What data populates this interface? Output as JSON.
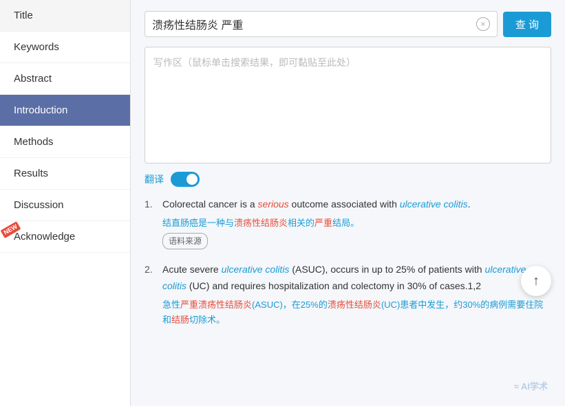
{
  "sidebar": {
    "items": [
      {
        "id": "title",
        "label": "Title",
        "active": false,
        "new": false
      },
      {
        "id": "keywords",
        "label": "Keywords",
        "active": false,
        "new": false
      },
      {
        "id": "abstract",
        "label": "Abstract",
        "active": false,
        "new": false
      },
      {
        "id": "introduction",
        "label": "Introduction",
        "active": true,
        "new": false
      },
      {
        "id": "methods",
        "label": "Methods",
        "active": false,
        "new": false
      },
      {
        "id": "results",
        "label": "Results",
        "active": false,
        "new": false
      },
      {
        "id": "discussion",
        "label": "Discussion",
        "active": false,
        "new": false
      },
      {
        "id": "acknowledge",
        "label": "Acknowledge",
        "active": false,
        "new": true
      }
    ]
  },
  "search": {
    "query": "溃疡性结肠炎 严重",
    "button_label": "查 询",
    "clear_icon": "×"
  },
  "writing_area": {
    "placeholder": "写作区（鼠标单击搜索结果，即可黏贴至此处）"
  },
  "translate": {
    "label": "翻译",
    "enabled": true
  },
  "results": [
    {
      "number": "1.",
      "en_parts": [
        {
          "text": "Colorectal cancer is a ",
          "type": "normal"
        },
        {
          "text": "serious",
          "type": "italic-red"
        },
        {
          "text": " outcome associated with ",
          "type": "normal"
        },
        {
          "text": "ulcerative colitis",
          "type": "italic-blue"
        },
        {
          "text": ".",
          "type": "normal"
        }
      ],
      "cn_parts": [
        {
          "text": "结直肠癌是一种与",
          "type": "normal"
        },
        {
          "text": "溃疡性结肠炎",
          "type": "cn-red"
        },
        {
          "text": "相关的",
          "type": "normal"
        },
        {
          "text": "严重",
          "type": "cn-red"
        },
        {
          "text": "结局。",
          "type": "normal"
        }
      ],
      "source": "语料来源"
    },
    {
      "number": "2.",
      "en_parts": [
        {
          "text": "Acute severe ",
          "type": "normal"
        },
        {
          "text": "ulcerative colitis",
          "type": "italic-blue"
        },
        {
          "text": " (ASUC), occurs in up to 25% of patients with ",
          "type": "normal"
        },
        {
          "text": "ulcerative colitis",
          "type": "italic-blue"
        },
        {
          "text": " (UC) and requires hospitalization and colectomy in 30% of cases.1,2",
          "type": "normal"
        }
      ],
      "cn_parts": [
        {
          "text": "急性",
          "type": "normal"
        },
        {
          "text": "严重溃疡性结肠炎",
          "type": "cn-red"
        },
        {
          "text": "(ASUC)，在25%的",
          "type": "normal"
        },
        {
          "text": "溃疡性结肠炎",
          "type": "cn-red"
        },
        {
          "text": "(UC)患者中发生，约30%的病例需要住院和",
          "type": "normal"
        },
        {
          "text": "结肠",
          "type": "cn-red"
        },
        {
          "text": "切除术。",
          "type": "normal"
        }
      ],
      "source": null
    }
  ],
  "watermark": "≈ AI学术",
  "new_badge_label": "NEW",
  "scroll_up_icon": "↑"
}
